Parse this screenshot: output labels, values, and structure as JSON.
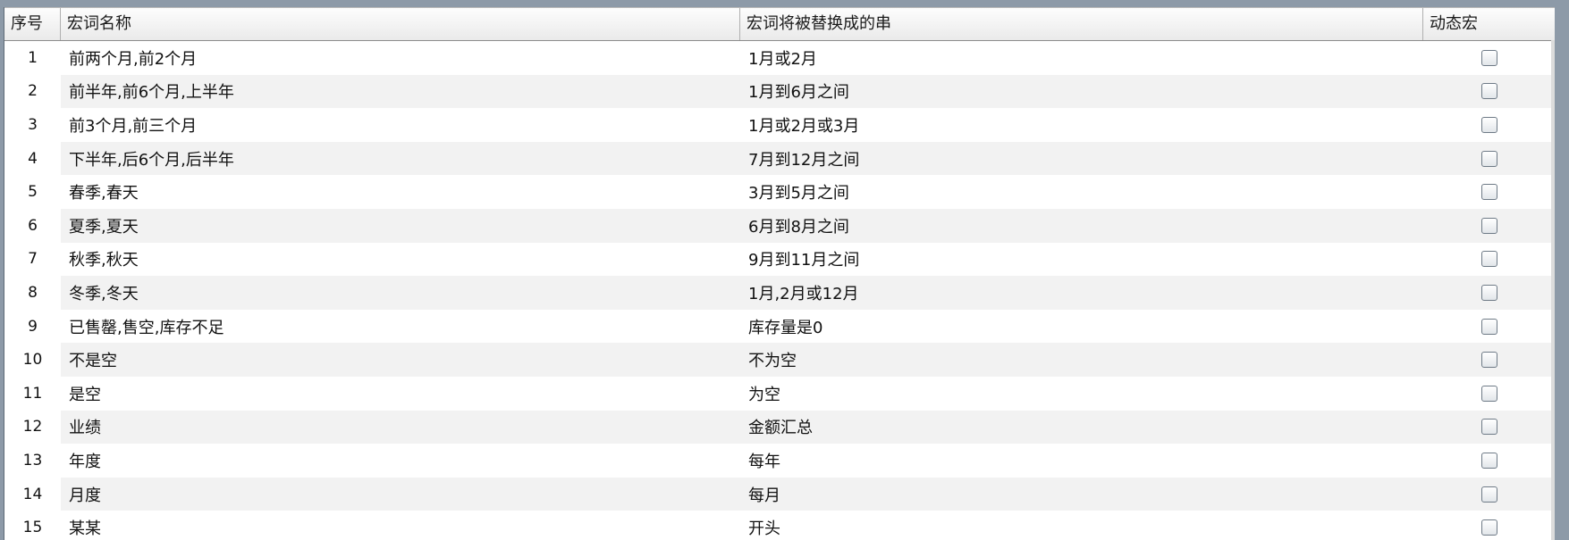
{
  "table": {
    "headers": {
      "index": "序号",
      "name": "宏词名称",
      "replacement": "宏词将被替换成的串",
      "dynamic": "动态宏"
    },
    "rows": [
      {
        "index": "1",
        "name": "前两个月,前2个月",
        "replacement": "1月或2月",
        "dynamic": false
      },
      {
        "index": "2",
        "name": "前半年,前6个月,上半年",
        "replacement": "1月到6月之间",
        "dynamic": false
      },
      {
        "index": "3",
        "name": "前3个月,前三个月",
        "replacement": "1月或2月或3月",
        "dynamic": false
      },
      {
        "index": "4",
        "name": "下半年,后6个月,后半年",
        "replacement": "7月到12月之间",
        "dynamic": false
      },
      {
        "index": "5",
        "name": "春季,春天",
        "replacement": "3月到5月之间",
        "dynamic": false
      },
      {
        "index": "6",
        "name": "夏季,夏天",
        "replacement": "6月到8月之间",
        "dynamic": false
      },
      {
        "index": "7",
        "name": "秋季,秋天",
        "replacement": "9月到11月之间",
        "dynamic": false
      },
      {
        "index": "8",
        "name": "冬季,冬天",
        "replacement": "1月,2月或12月",
        "dynamic": false
      },
      {
        "index": "9",
        "name": "已售罄,售空,库存不足",
        "replacement": "库存量是0",
        "dynamic": false
      },
      {
        "index": "10",
        "name": "不是空",
        "replacement": "不为空",
        "dynamic": false
      },
      {
        "index": "11",
        "name": "是空",
        "replacement": "为空",
        "dynamic": false
      },
      {
        "index": "12",
        "name": "业绩",
        "replacement": "金额汇总",
        "dynamic": false
      },
      {
        "index": "13",
        "name": "年度",
        "replacement": "每年",
        "dynamic": false
      },
      {
        "index": "14",
        "name": "月度",
        "replacement": "每月",
        "dynamic": false
      },
      {
        "index": "15",
        "name": "某某",
        "replacement": "开头",
        "dynamic": false
      }
    ]
  }
}
